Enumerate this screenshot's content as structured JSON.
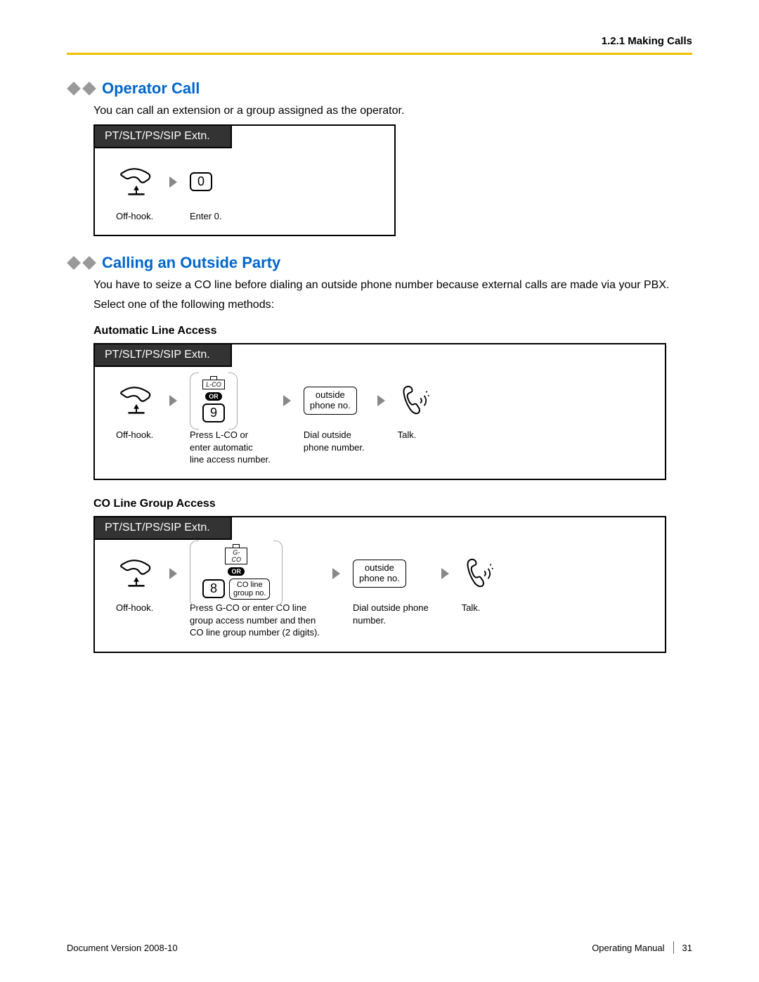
{
  "header": {
    "breadcrumb": "1.2.1 Making Calls"
  },
  "sections": {
    "operator": {
      "title": "Operator Call",
      "intro": "You can call an extension or a group assigned as the operator.",
      "tab": "PT/SLT/PS/SIP Extn.",
      "step1_caption": "Off-hook.",
      "step2_key": "0",
      "step2_caption": "Enter 0."
    },
    "outside": {
      "title": "Calling an Outside Party",
      "intro1": "You have to seize a CO line before dialing an outside phone number because external calls are made via your PBX.",
      "intro2": "Select one of the following methods:",
      "auto": {
        "heading": "Automatic Line Access",
        "tab": "PT/SLT/PS/SIP Extn.",
        "s1": "Off-hook.",
        "lco_label": "L-CO",
        "or": "OR",
        "key": "9",
        "s2": "Press L-CO or\nenter automatic\nline access number.",
        "phone_box": "outside\nphone no.",
        "s3": "Dial outside\nphone number.",
        "s4": "Talk."
      },
      "cogroup": {
        "heading": "CO Line Group Access",
        "tab": "PT/SLT/PS/SIP Extn.",
        "s1": "Off-hook.",
        "gco_label": "G-CO",
        "or": "OR",
        "key": "8",
        "group_box": "CO line\ngroup no.",
        "s2": "Press G-CO or enter CO line\ngroup access number and then\nCO line group number (2 digits).",
        "phone_box": "outside\nphone no.",
        "s3": "Dial outside phone\nnumber.",
        "s4": "Talk."
      }
    }
  },
  "footer": {
    "left": "Document Version  2008-10",
    "right_label": "Operating Manual",
    "page": "31"
  }
}
